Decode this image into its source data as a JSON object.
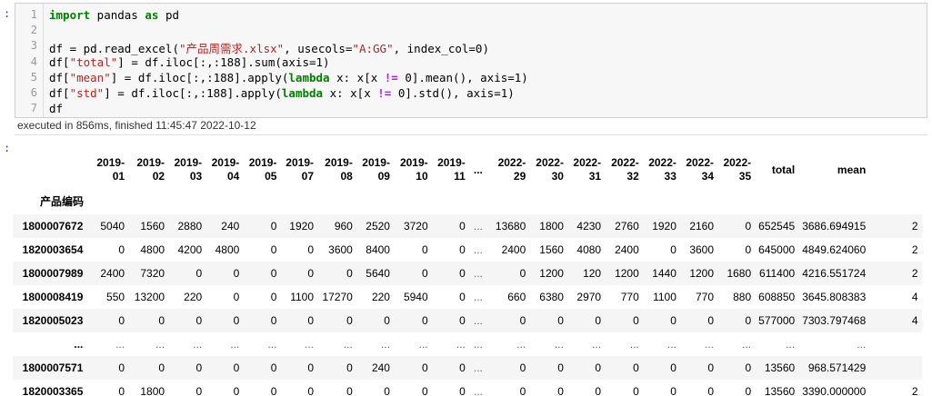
{
  "prompts": {
    "in": ":",
    "out": ":"
  },
  "code": {
    "line_numbers": [
      "1",
      "2",
      "3",
      "4",
      "5",
      "6",
      "7"
    ],
    "lines": [
      [
        {
          "t": "import",
          "c": "kw"
        },
        {
          "t": " pandas ",
          "c": ""
        },
        {
          "t": "as",
          "c": "kw"
        },
        {
          "t": " pd",
          "c": ""
        }
      ],
      [],
      [
        {
          "t": "df = pd.read_excel(",
          "c": ""
        },
        {
          "t": "\"产品周需求.xlsx\"",
          "c": "str"
        },
        {
          "t": ", usecols=",
          "c": ""
        },
        {
          "t": "\"A:GG\"",
          "c": "str"
        },
        {
          "t": ", index_col=0)",
          "c": ""
        }
      ],
      [
        {
          "t": "df[",
          "c": ""
        },
        {
          "t": "\"total\"",
          "c": "str"
        },
        {
          "t": "] = df.iloc[:,:188].sum(axis=1)",
          "c": ""
        }
      ],
      [
        {
          "t": "df[",
          "c": ""
        },
        {
          "t": "\"mean\"",
          "c": "str"
        },
        {
          "t": "] = df.iloc[:,:188].apply(",
          "c": ""
        },
        {
          "t": "lambda",
          "c": "kw"
        },
        {
          "t": " x: x[x ",
          "c": ""
        },
        {
          "t": "!=",
          "c": "op"
        },
        {
          "t": " 0].mean(), axis=1)",
          "c": ""
        }
      ],
      [
        {
          "t": "df[",
          "c": ""
        },
        {
          "t": "\"std\"",
          "c": "str"
        },
        {
          "t": "] = df.iloc[:,:188].apply(",
          "c": ""
        },
        {
          "t": "lambda",
          "c": "kw"
        },
        {
          "t": " x: x[x ",
          "c": ""
        },
        {
          "t": "!=",
          "c": "op"
        },
        {
          "t": " 0].std(), axis=1)",
          "c": ""
        }
      ],
      [
        {
          "t": "df",
          "c": ""
        }
      ]
    ]
  },
  "exec_info": "executed in 856ms, finished 11:45:47 2022-10-12",
  "table": {
    "index_name": "产品编码",
    "columns": [
      [
        "2019-",
        "01"
      ],
      [
        "2019-",
        "02"
      ],
      [
        "2019-",
        "03"
      ],
      [
        "2019-",
        "04"
      ],
      [
        "2019-",
        "05"
      ],
      [
        "2019-",
        "07"
      ],
      [
        "2019-",
        "08"
      ],
      [
        "2019-",
        "09"
      ],
      [
        "2019-",
        "10"
      ],
      [
        "2019-",
        "11"
      ],
      [
        "..."
      ],
      [
        "2022-",
        "29"
      ],
      [
        "2022-",
        "30"
      ],
      [
        "2022-",
        "31"
      ],
      [
        "2022-",
        "32"
      ],
      [
        "2022-",
        "33"
      ],
      [
        "2022-",
        "34"
      ],
      [
        "2022-",
        "35"
      ],
      [
        "total"
      ],
      [
        "mean"
      ],
      [
        ""
      ]
    ],
    "rows": [
      {
        "idx": "1800007672",
        "cells": [
          "5040",
          "1560",
          "2880",
          "240",
          "0",
          "1920",
          "960",
          "2520",
          "3720",
          "0",
          "...",
          "13680",
          "1800",
          "4230",
          "2760",
          "1920",
          "2160",
          "0",
          "652545",
          "3686.694915",
          "2"
        ]
      },
      {
        "idx": "1820003654",
        "cells": [
          "0",
          "4800",
          "4200",
          "4800",
          "0",
          "0",
          "3600",
          "8400",
          "0",
          "0",
          "...",
          "2400",
          "1560",
          "4080",
          "2400",
          "0",
          "3600",
          "0",
          "645000",
          "4849.624060",
          "2"
        ]
      },
      {
        "idx": "1800007989",
        "cells": [
          "2400",
          "7320",
          "0",
          "0",
          "0",
          "0",
          "0",
          "5640",
          "0",
          "0",
          "...",
          "0",
          "1200",
          "120",
          "1200",
          "1440",
          "1200",
          "1680",
          "611400",
          "4216.551724",
          "2"
        ]
      },
      {
        "idx": "1800008419",
        "cells": [
          "550",
          "13200",
          "220",
          "0",
          "0",
          "1100",
          "17270",
          "220",
          "5940",
          "0",
          "...",
          "660",
          "6380",
          "2970",
          "770",
          "1100",
          "770",
          "880",
          "608850",
          "3645.808383",
          "4"
        ]
      },
      {
        "idx": "1820005023",
        "cells": [
          "0",
          "0",
          "0",
          "0",
          "0",
          "0",
          "0",
          "0",
          "0",
          "0",
          "...",
          "0",
          "0",
          "0",
          "0",
          "0",
          "0",
          "0",
          "577000",
          "7303.797468",
          "4"
        ]
      },
      {
        "idx": "...",
        "cells": [
          "...",
          "...",
          "...",
          "...",
          "...",
          "...",
          "...",
          "...",
          "...",
          "...",
          "...",
          "...",
          "...",
          "...",
          "...",
          "...",
          "...",
          "...",
          "...",
          "...",
          ""
        ]
      },
      {
        "idx": "1800007571",
        "cells": [
          "0",
          "0",
          "0",
          "0",
          "0",
          "0",
          "0",
          "240",
          "0",
          "0",
          "...",
          "0",
          "0",
          "0",
          "0",
          "0",
          "0",
          "0",
          "13560",
          "968.571429",
          ""
        ]
      },
      {
        "idx": "1820003365",
        "cells": [
          "0",
          "1800",
          "0",
          "0",
          "0",
          "0",
          "0",
          "0",
          "0",
          "0",
          "...",
          "0",
          "0",
          "0",
          "0",
          "0",
          "0",
          "0",
          "13560",
          "3390.000000",
          "2"
        ]
      }
    ]
  }
}
